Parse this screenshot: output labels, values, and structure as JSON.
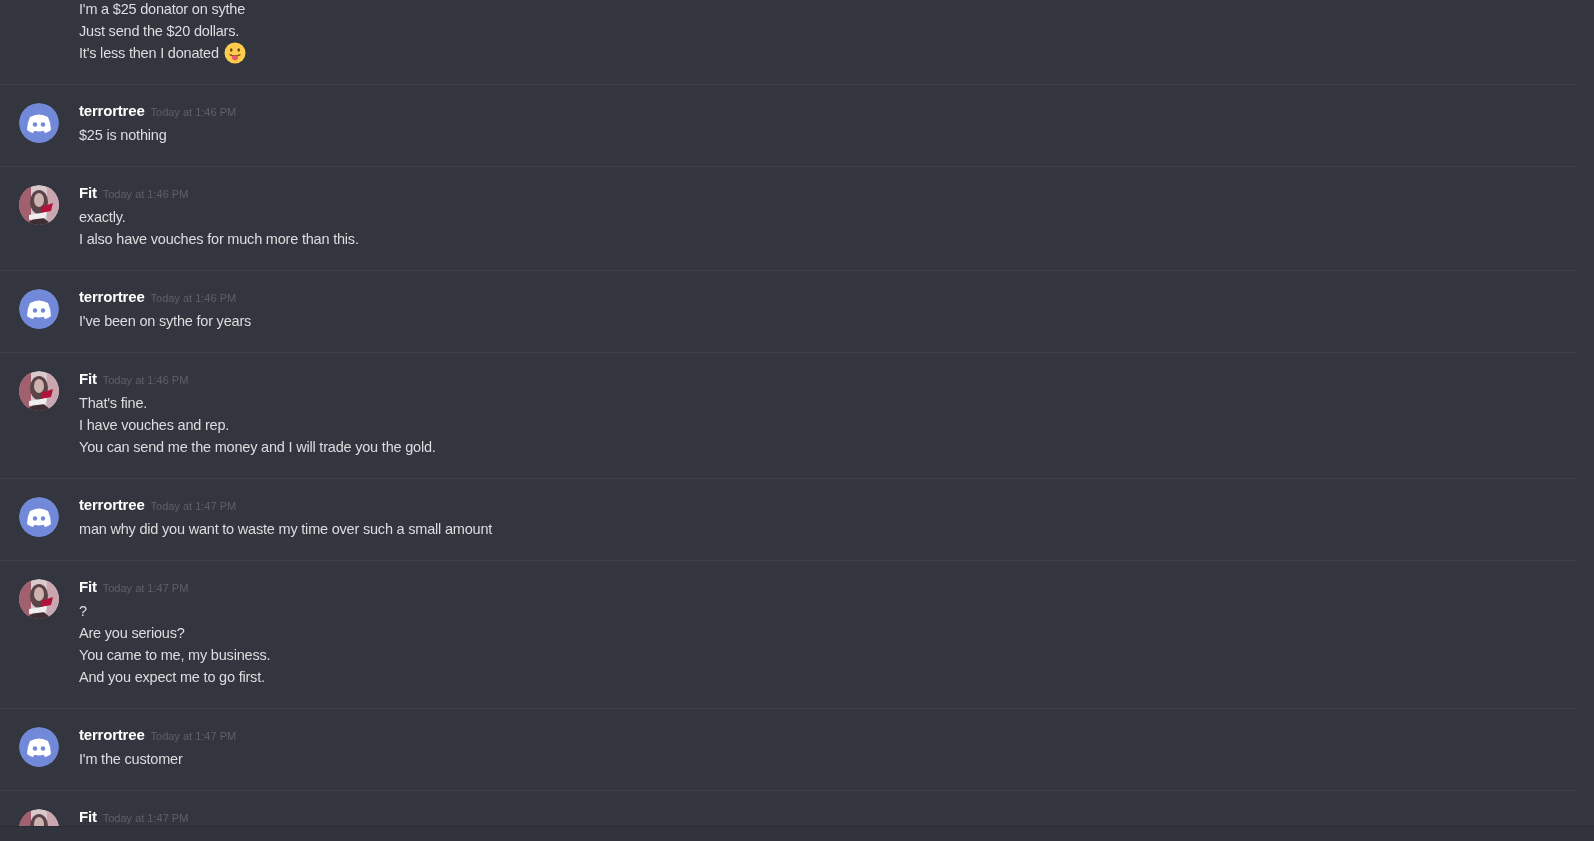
{
  "messages": [
    {
      "kind": "continuation",
      "lines": [
        {
          "kind": "plain",
          "text": "I'm a $25 donator on sythe"
        },
        {
          "kind": "plain",
          "text": "Just send the $20 dollars."
        },
        {
          "kind": "tongue_emoji",
          "text": "It's less then I donated"
        }
      ]
    },
    {
      "kind": "discord",
      "author": "terrortree",
      "timestamp": "Today at 1:46 PM",
      "lines": [
        {
          "kind": "plain",
          "text": "$25 is nothing"
        }
      ]
    },
    {
      "kind": "picture",
      "author": "Fit",
      "timestamp": "Today at 1:46 PM",
      "lines": [
        {
          "kind": "plain",
          "text": "exactly."
        },
        {
          "kind": "plain",
          "text": "I also have vouches for much more than this."
        }
      ]
    },
    {
      "kind": "discord",
      "author": "terrortree",
      "timestamp": "Today at 1:46 PM",
      "lines": [
        {
          "kind": "plain",
          "text": "I've been on sythe for years"
        }
      ]
    },
    {
      "kind": "picture",
      "author": "Fit",
      "timestamp": "Today at 1:46 PM",
      "lines": [
        {
          "kind": "plain",
          "text": "That's fine."
        },
        {
          "kind": "plain",
          "text": "I have vouches and rep."
        },
        {
          "kind": "plain",
          "text": "You can send me the money and I will trade you the gold."
        }
      ]
    },
    {
      "kind": "discord",
      "author": "terrortree",
      "timestamp": "Today at 1:47 PM",
      "lines": [
        {
          "kind": "plain",
          "text": "man why did you want to waste my time over such a small amount"
        }
      ]
    },
    {
      "kind": "picture",
      "author": "Fit",
      "timestamp": "Today at 1:47 PM",
      "lines": [
        {
          "kind": "plain",
          "text": "?"
        },
        {
          "kind": "plain",
          "text": "Are you serious?"
        },
        {
          "kind": "plain",
          "text": "You came to me, my business."
        },
        {
          "kind": "plain",
          "text": "And you expect me to go first."
        }
      ]
    },
    {
      "kind": "discord",
      "author": "terrortree",
      "timestamp": "Today at 1:47 PM",
      "lines": [
        {
          "kind": "plain",
          "text": "I'm the customer"
        }
      ]
    },
    {
      "kind": "picture",
      "author": "Fit",
      "timestamp": "Today at 1:47 PM"
    }
  ]
}
